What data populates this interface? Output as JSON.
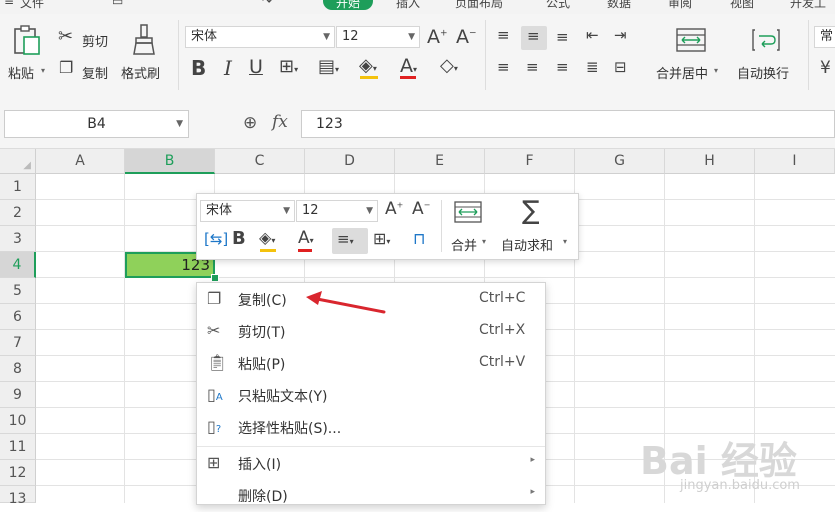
{
  "menu": {
    "file_label": "文件",
    "tabs": [
      "开始",
      "插入",
      "页面布局",
      "公式",
      "数据",
      "审阅",
      "视图",
      "开发工"
    ]
  },
  "ribbon": {
    "paste_label": "粘贴",
    "cut_label": "剪切",
    "copy_label": "复制",
    "format_painter_label": "格式刷",
    "font_name": "宋体",
    "font_size": "12",
    "merge_center_label": "合并居中",
    "wrap_text_label": "自动换行",
    "number_format": "常"
  },
  "formula_bar": {
    "name_box": "B4",
    "fx_label": "fx",
    "formula_value": "123"
  },
  "grid": {
    "columns": [
      "A",
      "B",
      "C",
      "D",
      "E",
      "F",
      "G",
      "H",
      "I"
    ],
    "rows": [
      "1",
      "2",
      "3",
      "4",
      "5",
      "6",
      "7",
      "8",
      "9",
      "10",
      "11",
      "12",
      "13"
    ],
    "selected_cell_value": "123"
  },
  "mini_toolbar": {
    "font_name": "宋体",
    "font_size": "12",
    "merge_label": "合并",
    "autosum_label": "自动求和"
  },
  "context_menu": {
    "items": [
      {
        "label": "复制(C)",
        "shortcut": "Ctrl+C"
      },
      {
        "label": "剪切(T)",
        "shortcut": "Ctrl+X"
      },
      {
        "label": "粘贴(P)",
        "shortcut": "Ctrl+V"
      },
      {
        "label": "只粘贴文本(Y)",
        "shortcut": ""
      },
      {
        "label": "选择性粘贴(S)...",
        "shortcut": ""
      },
      {
        "label": "插入(I)",
        "shortcut": ""
      },
      {
        "label": "删除(D)",
        "shortcut": ""
      }
    ]
  },
  "watermark": {
    "brand": "Bai 经验",
    "url": "jingyan.baidu.com"
  },
  "colors": {
    "accent_green": "#1e9e5a",
    "selected_fill": "#8fd15a",
    "annotation_arrow": "#d9262e"
  }
}
